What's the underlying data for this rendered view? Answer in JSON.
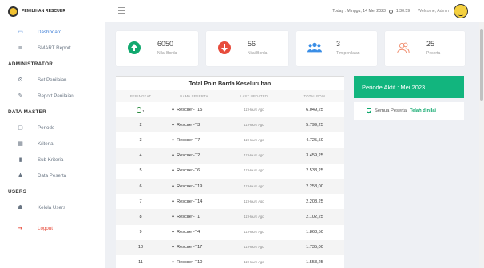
{
  "brand": {
    "name": "PEMILIHAN RESCUER"
  },
  "topbar": {
    "datetime": "Today : Minggu, 14 Mei 2023",
    "time": "1:30:59",
    "welcome": "Welcome, Admin"
  },
  "sidebar": {
    "dashboard": "Dashboard",
    "smart_report": "SMART Report",
    "section_admin": "ADMINISTRATOR",
    "set_penilaian": "Set Penilaian",
    "report_penilaian": "Report Penilaian",
    "section_master": "DATA MASTER",
    "periode": "Periode",
    "kriteria": "Kriteria",
    "sub_kriteria": "Sub Kriteria",
    "data_peserta": "Data Peserta",
    "section_users": "USERS",
    "kelola_users": "Kelola Users",
    "logout": "Logout"
  },
  "cards": [
    {
      "number": "6050",
      "label": "Nilai Borda",
      "icon": "arrow-up-circle-icon",
      "color": "#12a96f"
    },
    {
      "number": "56",
      "label": "Nilai Borda",
      "icon": "arrow-down-circle-icon",
      "color": "#e74c3c"
    },
    {
      "number": "3",
      "label": "Tim penilaian",
      "icon": "users-icon",
      "color": "#3a8ee6"
    },
    {
      "number": "25",
      "label": "Peserta",
      "icon": "user-outline-icon",
      "color": "#f08a6a"
    }
  ],
  "table": {
    "title": "Total Poin Borda Keseluruhan",
    "headers": [
      "PERINGKAT",
      "NAMA PESERTA",
      "LAST UPDATED",
      "TOTAL POIN"
    ],
    "rows": [
      {
        "rank": "1",
        "name": "Rescuer-T15",
        "updated": "11 Hours Ago",
        "total": "6.049,25"
      },
      {
        "rank": "2",
        "name": "Rescuer-T3",
        "updated": "11 Hours Ago",
        "total": "5.799,25"
      },
      {
        "rank": "3",
        "name": "Rescuer-T7",
        "updated": "11 Hours Ago",
        "total": "4.725,50"
      },
      {
        "rank": "4",
        "name": "Rescuer-T2",
        "updated": "11 Hours Ago",
        "total": "3.459,25"
      },
      {
        "rank": "5",
        "name": "Rescuer-T6",
        "updated": "11 Hours Ago",
        "total": "2.533,25"
      },
      {
        "rank": "6",
        "name": "Rescuer-T19",
        "updated": "11 Hours Ago",
        "total": "2.258,00"
      },
      {
        "rank": "7",
        "name": "Rescuer-T14",
        "updated": "11 Hours Ago",
        "total": "2.208,25"
      },
      {
        "rank": "8",
        "name": "Rescuer-T1",
        "updated": "11 Hours Ago",
        "total": "2.102,25"
      },
      {
        "rank": "9",
        "name": "Rescuer-T4",
        "updated": "11 Hours Ago",
        "total": "1.868,50"
      },
      {
        "rank": "10",
        "name": "Rescuer-T17",
        "updated": "11 Hours Ago",
        "total": "1.735,00"
      },
      {
        "rank": "11",
        "name": "Rescuer-T10",
        "updated": "11 Hours Ago",
        "total": "1.553,25"
      }
    ]
  },
  "periode": {
    "label": "Periode Aktif : Mei 2023"
  },
  "status": {
    "prefix": "Semua Peserta",
    "strong": "Telah dinilai"
  },
  "colors": {
    "accent": "#12b57e",
    "link": "#3a7bd5",
    "danger": "#e74c3c"
  }
}
